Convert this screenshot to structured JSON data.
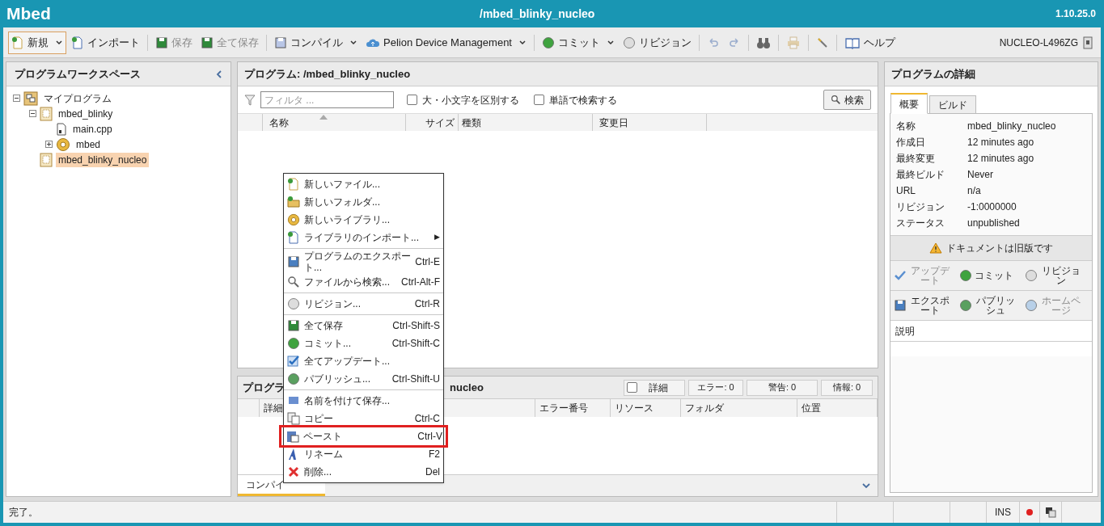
{
  "header": {
    "logo": "Mbed",
    "title": "/mbed_blinky_nucleo",
    "version": "1.10.25.0"
  },
  "toolbar": [
    {
      "kind": "button",
      "label": "新規",
      "dropdown": true,
      "focused": true,
      "disabled": false
    },
    {
      "kind": "button",
      "label": "インポート",
      "dropdown": false,
      "focused": false,
      "disabled": false
    },
    {
      "kind": "separator"
    },
    {
      "kind": "button",
      "label": "保存",
      "dropdown": false,
      "focused": false,
      "disabled": true
    },
    {
      "kind": "button",
      "label": "全て保存",
      "dropdown": false,
      "focused": false,
      "disabled": true
    },
    {
      "kind": "separator"
    },
    {
      "kind": "button",
      "label": "コンパイル",
      "dropdown": true,
      "focused": false,
      "disabled": false
    },
    {
      "kind": "button",
      "label": "Pelion Device Management",
      "dropdown": true,
      "focused": false,
      "disabled": false
    },
    {
      "kind": "separator"
    },
    {
      "kind": "button",
      "label": "コミット",
      "dropdown": true,
      "focused": false,
      "disabled": false
    },
    {
      "kind": "button",
      "label": "リビジョン",
      "dropdown": false,
      "focused": false,
      "disabled": false
    },
    {
      "kind": "separator"
    },
    {
      "kind": "icon",
      "disabled": true
    },
    {
      "kind": "icon",
      "disabled": true
    },
    {
      "kind": "separator"
    },
    {
      "kind": "icon",
      "disabled": false
    },
    {
      "kind": "separator"
    },
    {
      "kind": "icon",
      "disabled": true
    },
    {
      "kind": "separator"
    },
    {
      "kind": "icon",
      "disabled": false
    },
    {
      "kind": "separator"
    },
    {
      "kind": "button",
      "label": "ヘルプ",
      "dropdown": false,
      "focused": false,
      "disabled": false
    }
  ],
  "target": "NUCLEO-L496ZG",
  "workspace": {
    "title": "プログラムワークスペース",
    "tree": [
      {
        "kind": "workspace",
        "label": "マイプログラム",
        "expanded": true,
        "selected": false,
        "children": [
          {
            "kind": "program",
            "label": "mbed_blinky",
            "expanded": true,
            "selected": false,
            "children": [
              {
                "kind": "file",
                "label": "main.cpp",
                "selected": false
              },
              {
                "kind": "library",
                "label": "mbed",
                "expanded": false,
                "selected": false
              }
            ]
          },
          {
            "kind": "program",
            "label": "mbed_blinky_nucleo",
            "selected": true
          }
        ]
      }
    ]
  },
  "program": {
    "title": "プログラム: /mbed_blinky_nucleo",
    "filter_placeholder": "フィルタ ...",
    "options": [
      {
        "label": "大・小文字を区別する",
        "checked": false
      },
      {
        "label": "単語で検索する",
        "checked": false
      }
    ],
    "search_button": "検索",
    "columns": [
      {
        "label": "名称",
        "sorted": true
      },
      {
        "label": "サイズ",
        "sorted": false
      },
      {
        "label": "種類",
        "sorted": false
      },
      {
        "label": "変更日",
        "sorted": false
      }
    ]
  },
  "output": {
    "title_start": "プログラ",
    "title_end": "nucleo",
    "detail": {
      "label": "詳細",
      "checked": false
    },
    "counters": [
      "エラー: 0",
      "警告: 0",
      "情報: 0"
    ],
    "columns": [
      "詳細",
      "エラー番号",
      "リソース",
      "フォルダ",
      "位置"
    ],
    "tab": {
      "label": "コンパイ",
      "selected": true
    }
  },
  "details": {
    "title": "プログラムの詳細",
    "tabs": [
      {
        "label": "概要",
        "selected": true
      },
      {
        "label": "ビルド",
        "selected": false
      }
    ],
    "fields": [
      {
        "label": "名称",
        "value": "mbed_blinky_nucleo"
      },
      {
        "label": "作成日",
        "value": "12 minutes ago"
      },
      {
        "label": "最終変更",
        "value": "12 minutes ago"
      },
      {
        "label": "最終ビルド",
        "value": "Never"
      },
      {
        "label": "URL",
        "value": "n/a"
      },
      {
        "label": "リビジョン",
        "value": "-1:0000000"
      },
      {
        "label": "ステータス",
        "value": "unpublished"
      }
    ],
    "warning": "ドキュメントは旧版です",
    "actions": [
      [
        {
          "label": "アップデート",
          "disabled": true
        },
        {
          "label": "コミット",
          "disabled": false
        },
        {
          "label": "リビジョン",
          "disabled": false
        }
      ],
      [
        {
          "label": "エクスポート",
          "disabled": false
        },
        {
          "label": "パブリッシュ",
          "disabled": false
        },
        {
          "label": "ホームページ",
          "disabled": true
        }
      ]
    ],
    "description_label": "説明"
  },
  "context_menu": [
    [
      {
        "label": "新しいファイル...",
        "selected": false
      },
      {
        "label": "新しいフォルダ...",
        "selected": false
      },
      {
        "label": "新しいライブラリ...",
        "selected": false
      },
      {
        "label": "ライブラリのインポート...",
        "submenu": "▶",
        "selected": false
      }
    ],
    [
      {
        "label": "プログラムのエクスポート...",
        "shortcut": "Ctrl-E",
        "selected": false
      },
      {
        "label": "ファイルから検索...",
        "shortcut": "Ctrl-Alt-F",
        "selected": false
      }
    ],
    [
      {
        "label": "リビジョン...",
        "shortcut": "Ctrl-R",
        "selected": false
      }
    ],
    [
      {
        "label": "全て保存",
        "shortcut": "Ctrl-Shift-S",
        "selected": false
      },
      {
        "label": "コミット...",
        "shortcut": "Ctrl-Shift-C",
        "selected": false
      },
      {
        "label": "全てアップデート...",
        "selected": false
      },
      {
        "label": "パブリッシュ...",
        "shortcut": "Ctrl-Shift-U",
        "selected": false
      }
    ],
    [
      {
        "label": "名前を付けて保存...",
        "selected": false
      },
      {
        "label": "コピー",
        "shortcut": "Ctrl-C",
        "selected": false
      },
      {
        "label": "ペースト",
        "shortcut": "Ctrl-V",
        "selected": true
      },
      {
        "label": "リネーム",
        "shortcut": "F2",
        "selected": false
      },
      {
        "label": "削除...",
        "shortcut": "Del",
        "selected": false
      }
    ]
  ],
  "status": {
    "message": "完了。",
    "mode": "INS"
  }
}
